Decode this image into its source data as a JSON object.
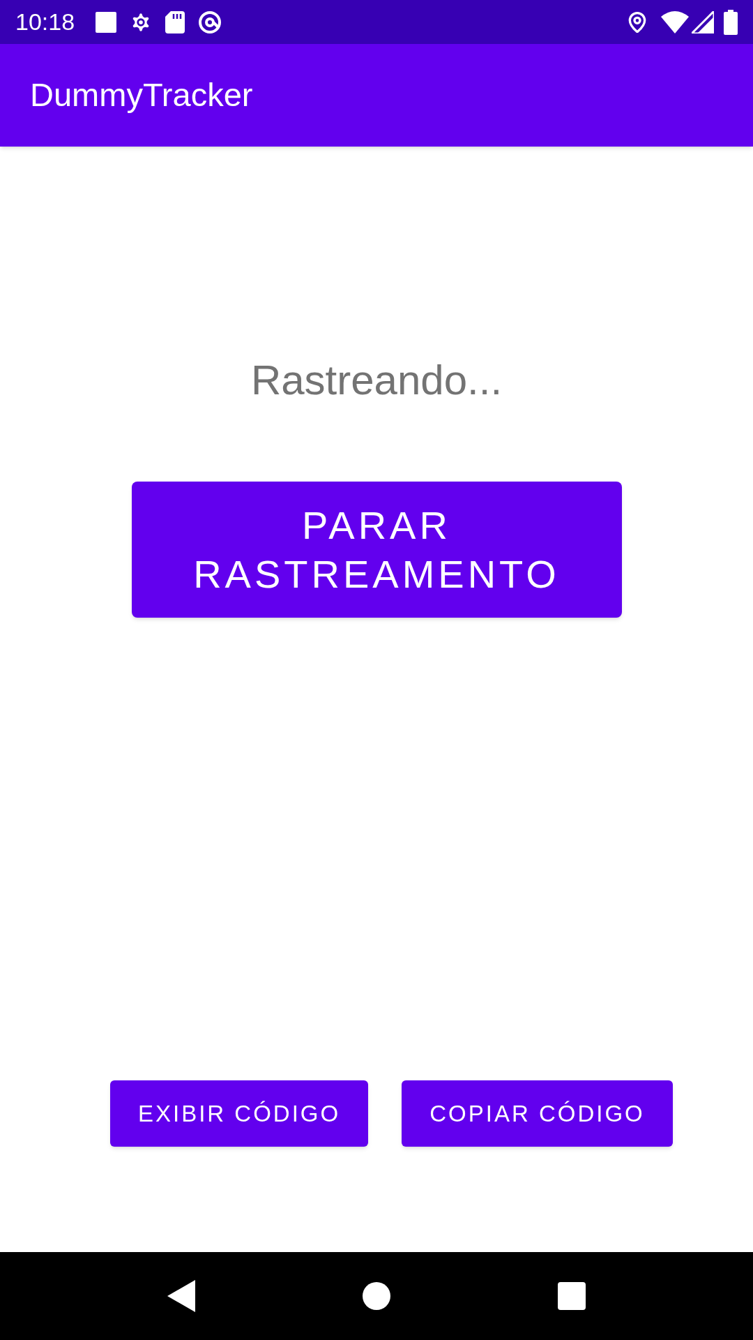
{
  "status_bar": {
    "time": "10:18"
  },
  "app_bar": {
    "title": "DummyTracker"
  },
  "status_text": "Rastreando...",
  "main_button": {
    "label": "PARAR RASTREAMENTO"
  },
  "buttons": [
    {
      "label": "EXIBIR CÓDIGO"
    },
    {
      "label": "COPIAR CÓDIGO"
    }
  ]
}
